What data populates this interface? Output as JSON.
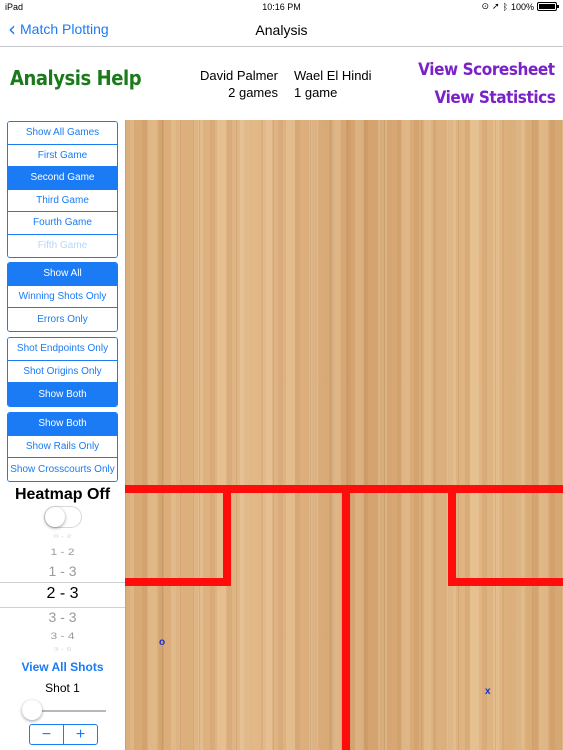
{
  "status_bar": {
    "device": "iPad",
    "time": "10:16 PM",
    "battery": "100%",
    "battery_level": 1.0
  },
  "nav": {
    "back_label": "Match Plotting",
    "title": "Analysis"
  },
  "header": {
    "help": "Analysis Help",
    "player1": {
      "name": "David Palmer",
      "games": "2 games"
    },
    "player2": {
      "name": "Wael El Hindi",
      "games": "1 game"
    },
    "view_scoresheet": "View Scoresheet",
    "view_statistics": "View Statistics"
  },
  "filters": {
    "games": [
      {
        "label": "Show All Games",
        "state": "normal"
      },
      {
        "label": "First Game",
        "state": "normal"
      },
      {
        "label": "Second Game",
        "state": "selected"
      },
      {
        "label": "Third Game",
        "state": "normal"
      },
      {
        "label": "Fourth Game",
        "state": "normal"
      },
      {
        "label": "Fifth Game",
        "state": "disabled"
      }
    ],
    "shot_types": [
      {
        "label": "Show All",
        "state": "selected"
      },
      {
        "label": "Winning Shots Only",
        "state": "normal"
      },
      {
        "label": "Errors Only",
        "state": "normal"
      }
    ],
    "points": [
      {
        "label": "Shot Endpoints Only",
        "state": "normal"
      },
      {
        "label": "Shot Origins Only",
        "state": "normal"
      },
      {
        "label": "Show Both",
        "state": "selected"
      }
    ],
    "directions": [
      {
        "label": "Show Both",
        "state": "selected"
      },
      {
        "label": "Show Rails Only",
        "state": "normal"
      },
      {
        "label": "Show Crosscourts Only",
        "state": "normal"
      }
    ]
  },
  "heatmap": {
    "label": "Heatmap Off",
    "on": false
  },
  "score_picker": {
    "options": [
      "0 - 2",
      "1 - 2",
      "1 - 3",
      "2 - 3",
      "3 - 3",
      "3 - 4",
      "3 - 5"
    ],
    "selected": "2 - 3"
  },
  "shots": {
    "view_all": "View All Shots",
    "current": "Shot 1",
    "minus": "−",
    "plus": "+",
    "slider_value": 0
  },
  "court": {
    "line_color": "#ff0d0d",
    "markers": [
      {
        "symbol": "o"
      },
      {
        "symbol": "x"
      }
    ]
  }
}
